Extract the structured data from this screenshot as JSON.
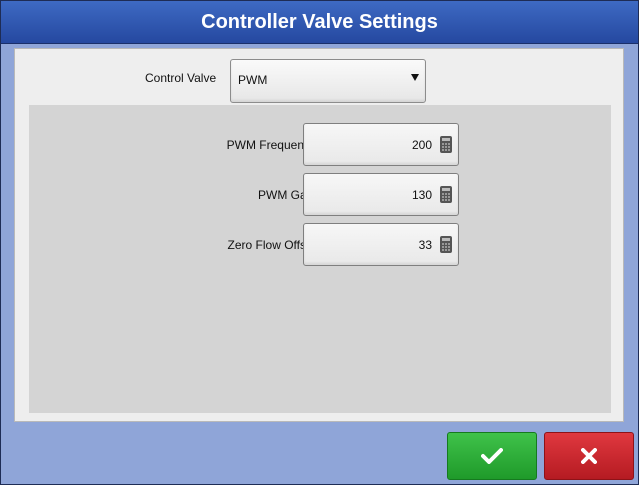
{
  "dialog": {
    "title": "Controller Valve Settings"
  },
  "control_valve": {
    "label": "Control Valve",
    "selected": "PWM"
  },
  "settings": [
    {
      "label": "PWM Frequency",
      "value": "200"
    },
    {
      "label": "PWM Gain",
      "value": "130"
    },
    {
      "label": "Zero Flow Offset",
      "value": "33"
    }
  ],
  "buttons": {
    "ok_icon": "checkmark-icon",
    "cancel_icon": "close-icon"
  },
  "colors": {
    "title_bar": "#2f58b2",
    "background": "#8fa5d8",
    "ok": "#2eaf3a",
    "cancel": "#cf2a31"
  }
}
